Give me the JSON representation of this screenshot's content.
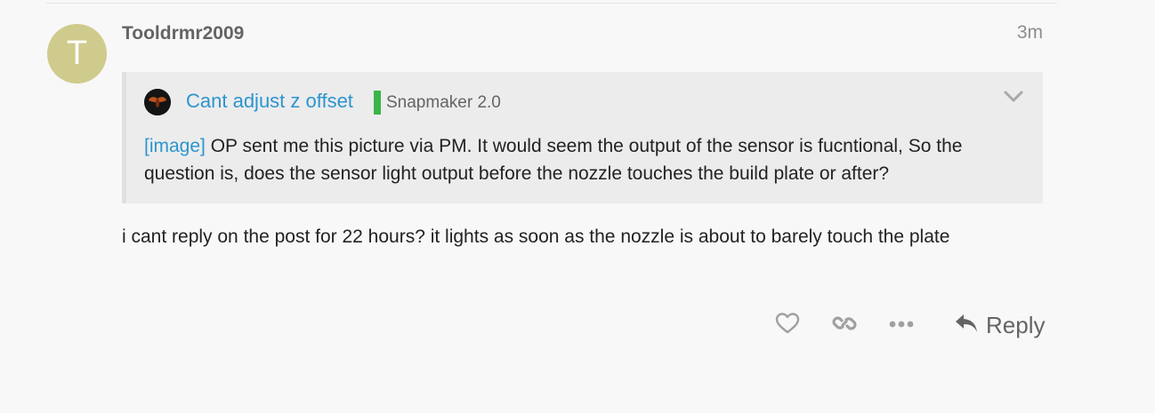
{
  "post": {
    "avatar_letter": "T",
    "avatar_color": "#cfcb8d",
    "username": "Tooldrmr2009",
    "date": "3m",
    "quote": {
      "topic_title": "Cant adjust z offset",
      "category": "Snapmaker 2.0",
      "category_color": "#3ab549",
      "image_link": "[image]",
      "body_text": " OP sent me this picture via PM. It would seem the output of the sensor is fucntional, So the question is, does the sensor light output before the nozzle touches the build plate or after?",
      "collapse_icon": "chevron-down-icon"
    },
    "body": "i cant reply on the post for 22 hours? it lights as soon as the nozzle is about to barely touch the plate",
    "actions": {
      "like_icon": "heart-icon",
      "link_icon": "link-icon",
      "more_icon": "ellipsis-icon",
      "reply_icon": "reply-arrow-icon",
      "reply_label": "Reply"
    }
  },
  "colors": {
    "link": "#2b95cf",
    "muted": "#646464",
    "icon": "#999999"
  }
}
